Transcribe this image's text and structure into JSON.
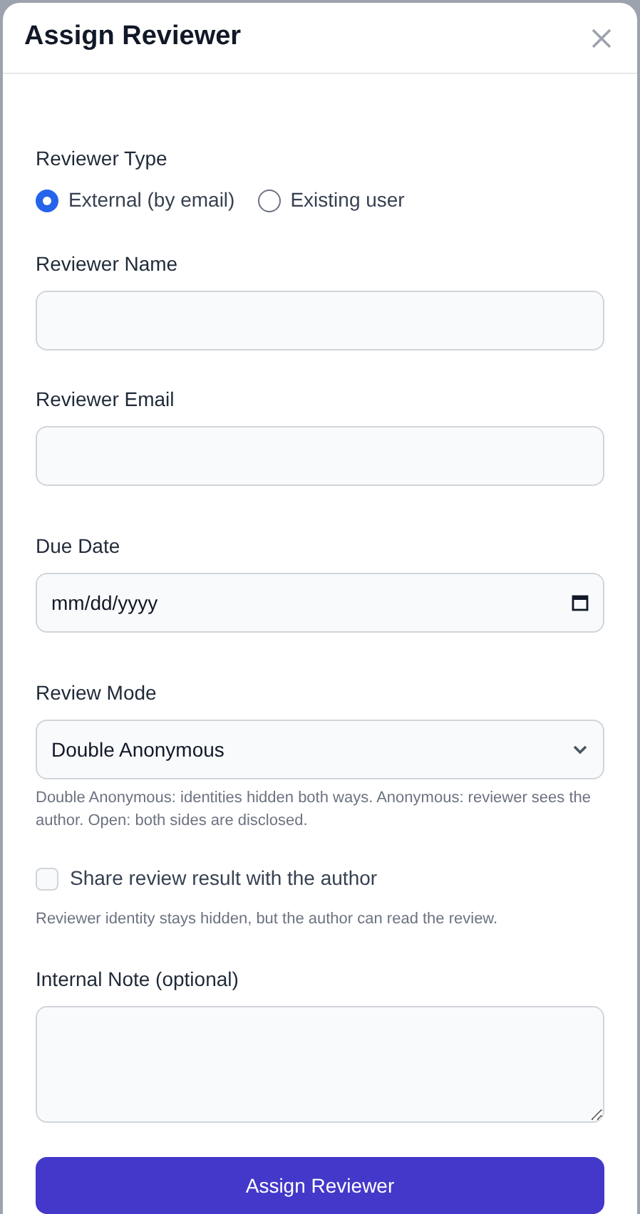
{
  "dialog": {
    "title": "Assign Reviewer"
  },
  "reviewer_type": {
    "label": "Reviewer Type",
    "options": [
      {
        "label": "External (by email)",
        "selected": true
      },
      {
        "label": "Existing user",
        "selected": false
      }
    ]
  },
  "reviewer_name": {
    "label": "Reviewer Name"
  },
  "reviewer_email": {
    "label": "Reviewer Email"
  },
  "due_date": {
    "label": "Due Date",
    "placeholder": "mm/dd/yyyy"
  },
  "review_mode": {
    "label": "Review Mode",
    "value": "Double Anonymous",
    "help": "Double Anonymous: identities hidden both ways. Anonymous: reviewer sees the author. Open: both sides are disclosed."
  },
  "share_result": {
    "label": "Share review result with the author",
    "checked": false,
    "help": "Reviewer identity stays hidden, but the author can read the review."
  },
  "internal_note": {
    "label": "Internal Note (optional)"
  },
  "submit": {
    "label": "Assign Reviewer"
  }
}
